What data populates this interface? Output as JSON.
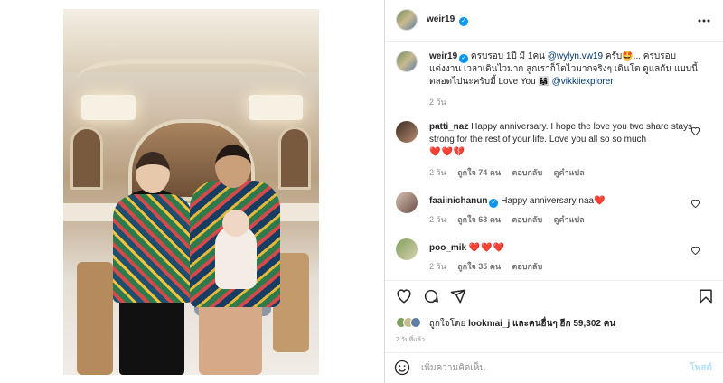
{
  "post": {
    "author": "weir19",
    "verified": true
  },
  "caption": {
    "username": "weir19",
    "text_part1": " ครบรอบ 1ปี มี 1คน ",
    "mention1": "@wylyn.vw19",
    "text_part2": " ครับ🤩... ครบรอบแต่งงาน เวลาเดินไวมาก ลูกเราก็โตไวมากจริงๆ เดินโต ดูแลกัน แบบนี้ตลอดไปนะครับมี้ Love You 👨‍👩‍👧 ",
    "mention2": "@vikkiiexplorer",
    "time": "2 วัน"
  },
  "comments": [
    {
      "username": "patti_naz",
      "text": "Happy anniversary. I hope the love you two share stays strong for the rest of your life. Love you all so so much",
      "emoji": "❤️❤️💔",
      "time": "2 วัน",
      "likes": "ถูกใจ 74 คน",
      "reply": "ตอบกลับ",
      "translate": "ดูคำแปล"
    },
    {
      "username": "faaiinichanun",
      "verified": true,
      "text": "Happy anniversary naa❤️",
      "time": "2 วัน",
      "likes": "ถูกใจ 63 คน",
      "reply": "ตอบกลับ",
      "translate": "ดูคำแปล"
    },
    {
      "username": "poo_mik",
      "text": "❤️❤️❤️",
      "time": "2 วัน",
      "likes": "ถูกใจ 35 คน",
      "reply": "ตอบกลับ"
    }
  ],
  "likes": {
    "prefix": "ถูกใจโดย ",
    "user": "lookmai_j",
    "middle": " และคนอื่นๆ อีก ",
    "count": "59,302",
    "suffix": " คน"
  },
  "posted": "2 วันที่แล้ว",
  "comment_box": {
    "placeholder": "เพิ่มความคิดเห็น",
    "post_label": "โพสต์"
  },
  "icons": {
    "more": "more-options-icon",
    "like": "heart-icon",
    "comment": "comment-icon",
    "share": "share-icon",
    "save": "bookmark-icon",
    "emoji": "emoji-icon"
  },
  "colors": {
    "verified": "#0095f6",
    "link": "#00376b",
    "heart": "#ed4956",
    "post_disabled": "#b2dffc"
  }
}
